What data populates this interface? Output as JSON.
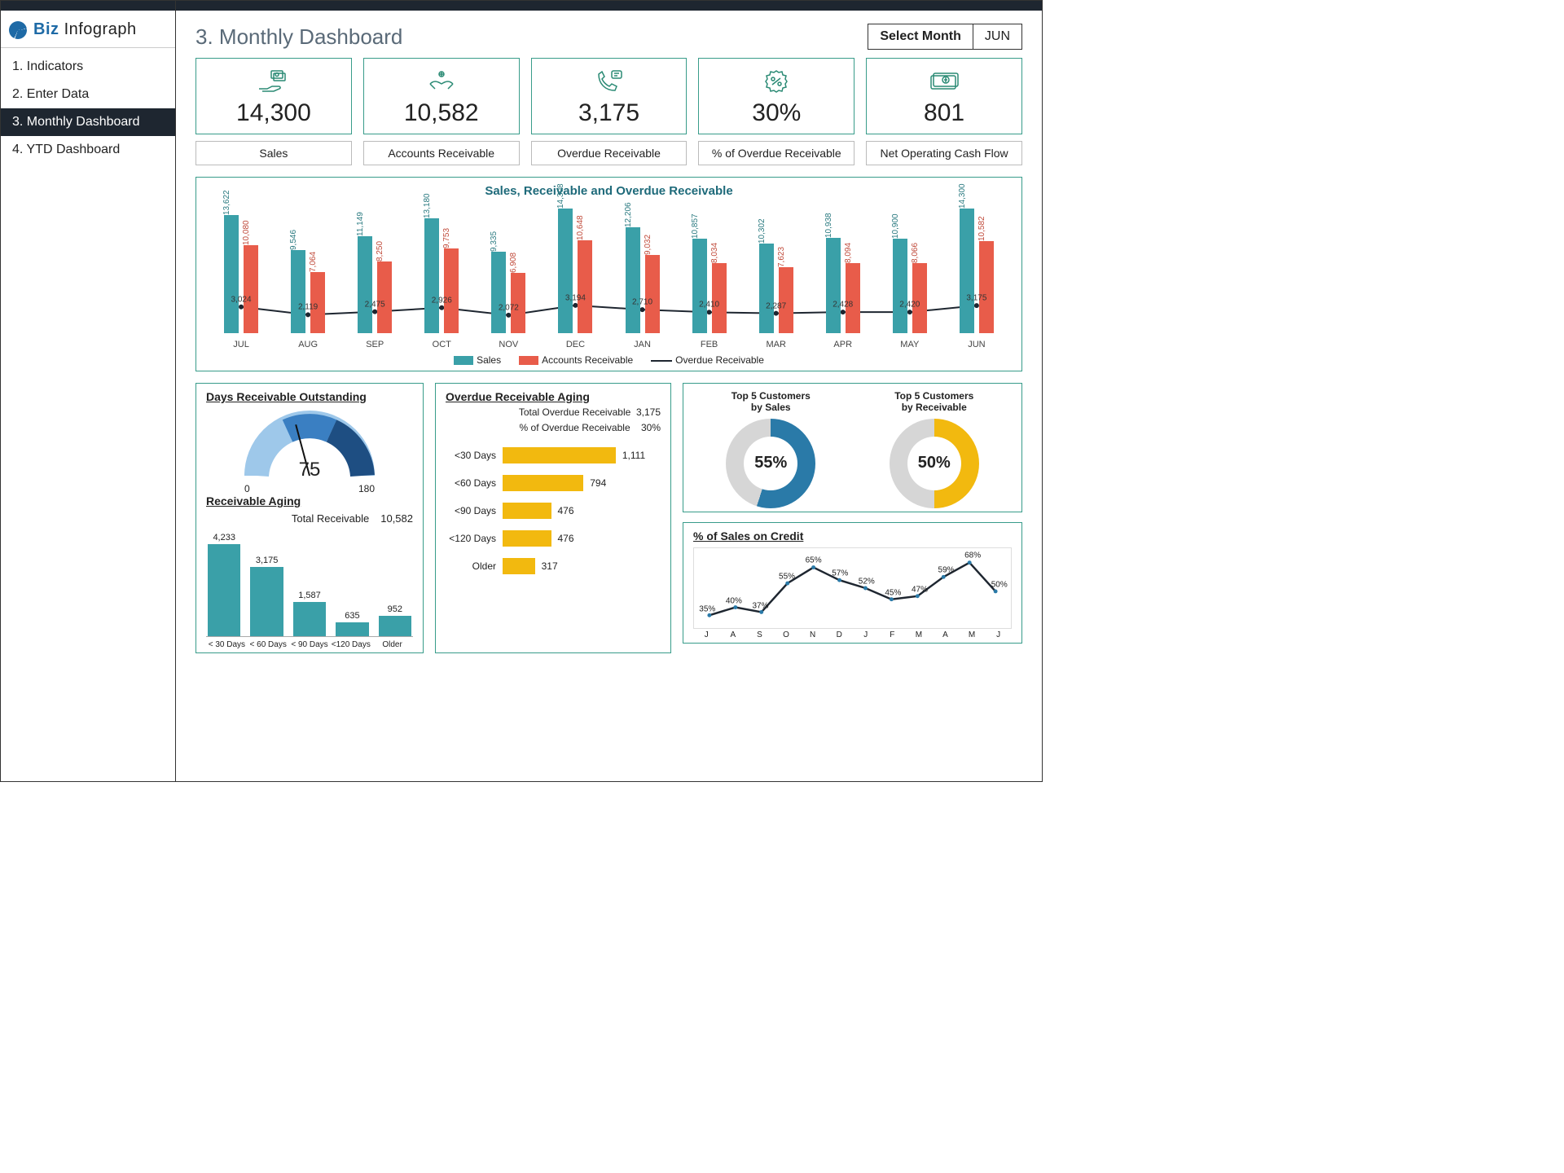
{
  "brand": {
    "part1": "Biz ",
    "part2": "Infograph"
  },
  "nav": [
    {
      "label": "1. Indicators"
    },
    {
      "label": "2. Enter Data"
    },
    {
      "label": "3. Monthly Dashboard"
    },
    {
      "label": "4. YTD Dashboard"
    }
  ],
  "nav_active_index": 2,
  "page_title": "3. Monthly Dashboard",
  "month_selector": {
    "label": "Select Month",
    "value": "JUN"
  },
  "kpi": [
    {
      "value": "14,300",
      "label": "Sales"
    },
    {
      "value": "10,582",
      "label": "Accounts Receivable"
    },
    {
      "value": "3,175",
      "label": "Overdue Receivable"
    },
    {
      "value": "30%",
      "label": "% of Overdue Receivable"
    },
    {
      "value": "801",
      "label": "Net Operating Cash Flow"
    }
  ],
  "big_chart_title": "Sales, Receivable and Overdue Receivable",
  "big_legend": {
    "sales": "Sales",
    "ar": "Accounts Receivable",
    "or": "Overdue Receivable"
  },
  "dro": {
    "title": "Days Receivable Outstanding",
    "value": 75,
    "min": 0,
    "max": 180
  },
  "receivable_aging": {
    "title": "Receivable Aging",
    "total_label": "Total Receivable",
    "total_value": "10,582"
  },
  "overdue_aging": {
    "title": "Overdue Receivable Aging",
    "total_label": "Total  Overdue Receivable",
    "total_value": "3,175",
    "pct_label": "% of Overdue Receivable",
    "pct_value": "30%"
  },
  "top5": {
    "sales": {
      "title_l1": "Top 5 Customers",
      "title_l2": "by Sales",
      "pct": "55%",
      "pct_num": 55
    },
    "recv": {
      "title_l1": "Top 5 Customers",
      "title_l2": "by Receivable",
      "pct": "50%",
      "pct_num": 50
    }
  },
  "credit": {
    "title": "% of Sales on Credit"
  },
  "chart_data": [
    {
      "id": "sales_recv_overdue",
      "type": "bar+line",
      "categories": [
        "JUL",
        "AUG",
        "SEP",
        "OCT",
        "NOV",
        "DEC",
        "JAN",
        "FEB",
        "MAR",
        "APR",
        "MAY",
        "JUN"
      ],
      "series": [
        {
          "name": "Sales",
          "type": "bar",
          "color": "#3aa0a8",
          "values": [
            13622,
            9546,
            11149,
            13180,
            9335,
            14308,
            12206,
            10857,
            10302,
            10938,
            10900,
            14300
          ],
          "value_labels": [
            "13,622",
            "9,546",
            "11,149",
            "13,180",
            "9,335",
            "14,308",
            "12,206",
            "10,857",
            "10,302",
            "10,938",
            "10,900",
            "14,300"
          ]
        },
        {
          "name": "Accounts Receivable",
          "type": "bar",
          "color": "#e85c4a",
          "values": [
            10080,
            7064,
            8250,
            9753,
            6908,
            10648,
            9032,
            8034,
            7623,
            8094,
            8066,
            10582
          ],
          "value_labels": [
            "10,080",
            "7,064",
            "8,250",
            "9,753",
            "6,908",
            "10,648",
            "9,032",
            "8,034",
            "7,623",
            "8,094",
            "8,066",
            "10,582"
          ]
        },
        {
          "name": "Overdue Receivable",
          "type": "line",
          "color": "#1e2630",
          "values": [
            3024,
            2119,
            2475,
            2926,
            2072,
            3194,
            2710,
            2410,
            2287,
            2428,
            2420,
            3175
          ],
          "value_labels": [
            "3,024",
            "2,119",
            "2,475",
            "2,926",
            "2,072",
            "3,194",
            "2,710",
            "2,410",
            "2,287",
            "2,428",
            "2,420",
            "3,175"
          ]
        }
      ],
      "ylim": [
        0,
        15000
      ]
    },
    {
      "id": "days_receivable_outstanding",
      "type": "gauge",
      "value": 75,
      "min": 0,
      "max": 180
    },
    {
      "id": "receivable_aging",
      "type": "bar",
      "categories": [
        "< 30 Days",
        "< 60 Days",
        "< 90 Days",
        "<120 Days",
        "Older"
      ],
      "values": [
        4233,
        3175,
        1587,
        635,
        952
      ],
      "value_labels": [
        "4,233",
        "3,175",
        "1,587",
        "635",
        "952"
      ],
      "ylim": [
        0,
        4500
      ],
      "color": "#3aa0a8"
    },
    {
      "id": "overdue_receivable_aging",
      "type": "hbar",
      "categories": [
        "<30 Days",
        "<60 Days",
        "<90 Days",
        "<120 Days",
        "Older"
      ],
      "values": [
        1111,
        794,
        476,
        476,
        317
      ],
      "value_labels": [
        "1,111",
        "794",
        "476",
        "476",
        "317"
      ],
      "xlim": [
        0,
        1200
      ],
      "color": "#f2b90f"
    },
    {
      "id": "top5_customers_by_sales",
      "type": "donut",
      "value": 55,
      "color": "#2a7aa8",
      "rest_color": "#d6d6d6"
    },
    {
      "id": "top5_customers_by_receivable",
      "type": "donut",
      "value": 50,
      "color": "#f2b90f",
      "rest_color": "#d6d6d6"
    },
    {
      "id": "pct_sales_on_credit",
      "type": "line",
      "categories": [
        "J",
        "A",
        "S",
        "O",
        "N",
        "D",
        "J",
        "F",
        "M",
        "A",
        "M",
        "J"
      ],
      "values": [
        35,
        40,
        37,
        55,
        65,
        57,
        52,
        45,
        47,
        59,
        68,
        50
      ],
      "value_labels": [
        "35%",
        "40%",
        "37%",
        "55%",
        "65%",
        "57%",
        "52%",
        "45%",
        "47%",
        "59%",
        "68%",
        "50%"
      ],
      "ylim": [
        30,
        70
      ],
      "color": "#1e2630"
    }
  ]
}
